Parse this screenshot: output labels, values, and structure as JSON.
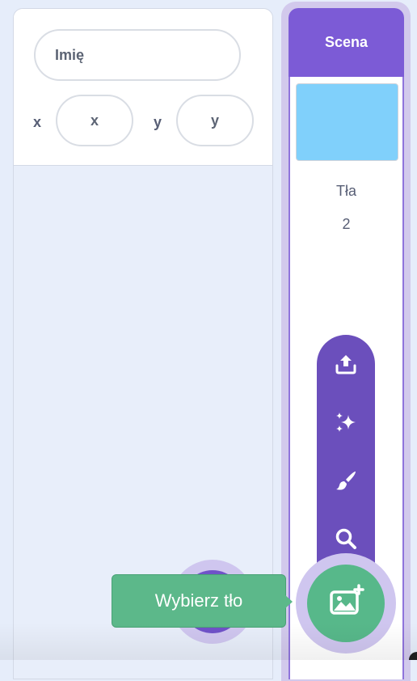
{
  "sprite_info": {
    "name_placeholder": "Imię",
    "x_label": "x",
    "x_placeholder": "x",
    "y_label": "y",
    "y_placeholder": "y"
  },
  "stage": {
    "title": "Scena",
    "backdrops_label": "Tła",
    "backdrops_count": "2",
    "thumbnail_color": "#80d0fb"
  },
  "backdrop_menu": {
    "items": [
      {
        "icon": "upload-icon"
      },
      {
        "icon": "surprise-sparkles-icon"
      },
      {
        "icon": "paint-brush-icon"
      },
      {
        "icon": "search-icon"
      }
    ]
  },
  "choose_backdrop": {
    "icon": "add-backdrop-image-icon",
    "tooltip": "Wybierz tło"
  },
  "colors": {
    "stage_header": "#7c5bd6",
    "menu": "#6b4fbc",
    "fab_green": "#57b88a",
    "tooltip": "#5cb88a",
    "halo": "#cfc6ef"
  }
}
